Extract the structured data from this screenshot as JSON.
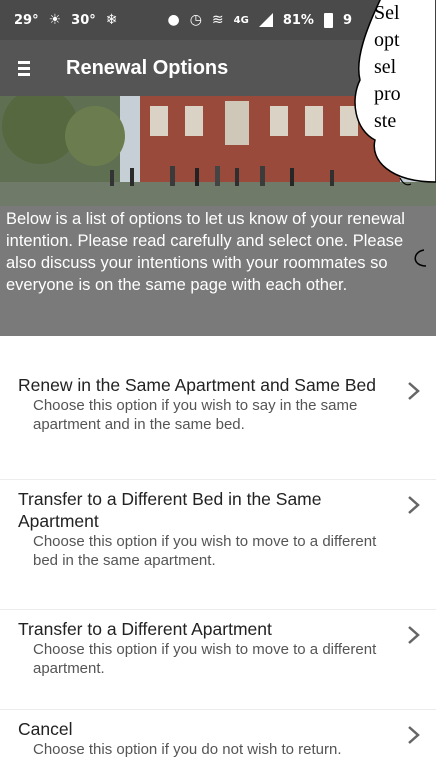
{
  "status_bar": {
    "temp_1": "29°",
    "temp_2": "30°",
    "network": "4G",
    "battery_pct": "81%",
    "clipped_text": "9"
  },
  "app_bar": {
    "title": "Renewal Options"
  },
  "intro": {
    "text": "Below is a list of options to let us know of your renewal intention. Please read carefully and select one. Please also discuss your intentions with your roommates so everyone is on the same page with each other."
  },
  "options": [
    {
      "title": "Renew in the Same Apartment and Same Bed",
      "description": "Choose this option if you wish to say in the same apartment and in the same bed."
    },
    {
      "title": "Transfer to a Different Bed in the Same Apartment",
      "description": "Choose this option if you wish to move to a different bed in the same apartment."
    },
    {
      "title": "Transfer to a Different Apartment",
      "description": "Choose this option if you wish to move to a different apartment."
    },
    {
      "title": "Cancel",
      "description": "Choose this option if you do not wish to return."
    }
  ],
  "callout": {
    "lines": [
      "Sel",
      "opt",
      "sel",
      "pro",
      "ste"
    ]
  },
  "colors": {
    "status_bar": "#4a4a4a",
    "app_bar": "#555555",
    "intro_background": "#7a7a7a",
    "chevron": "#666666"
  }
}
